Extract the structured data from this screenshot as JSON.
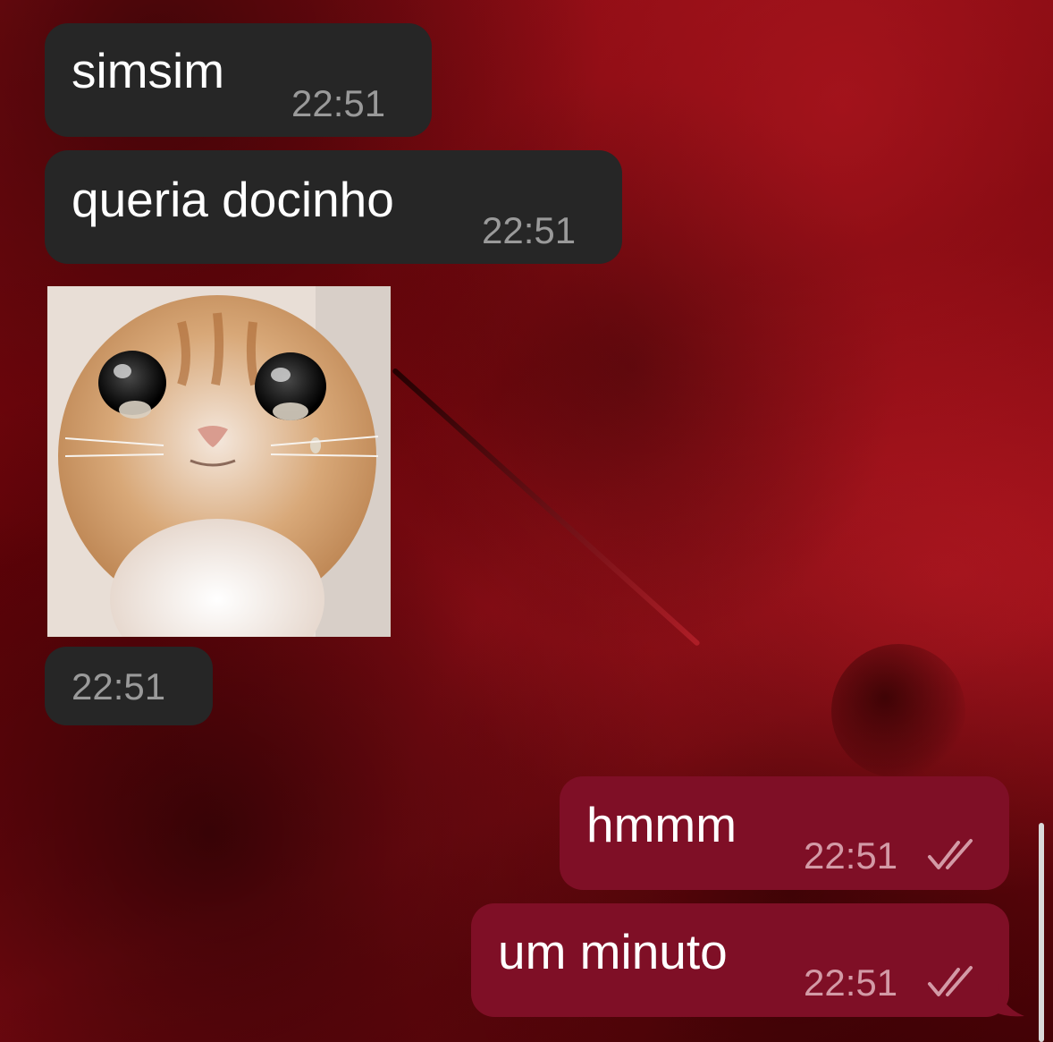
{
  "messages": [
    {
      "direction": "incoming",
      "text": "simsim",
      "time": "22:51"
    },
    {
      "direction": "incoming",
      "text": "queria docinho",
      "time": "22:51"
    },
    {
      "direction": "incoming",
      "type": "image",
      "image_subject": "crying orange kitten",
      "time": "22:51"
    },
    {
      "direction": "outgoing",
      "text": "hmmm",
      "time": "22:51",
      "status": "read",
      "status_icon": "double-check-icon"
    },
    {
      "direction": "outgoing",
      "text": "um minuto",
      "time": "22:51",
      "status": "read",
      "status_icon": "double-check-icon"
    }
  ],
  "colors": {
    "incoming_bubble": "#262626",
    "outgoing_bubble": "#7f0f26",
    "wallpaper_tint": "#8e0c14",
    "timestamp_incoming": "#9a9a9a",
    "timestamp_outgoing": "#d39aa6"
  }
}
